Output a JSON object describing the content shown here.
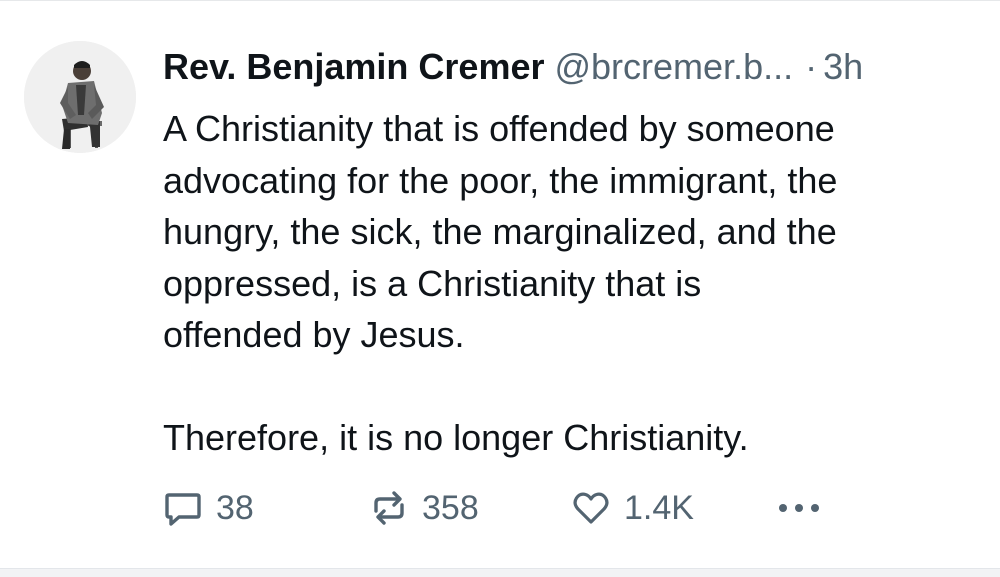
{
  "post": {
    "author_name": "Rev. Benjamin Cremer",
    "author_handle": "@brcremer.b...",
    "separator": "·",
    "timestamp": "3h",
    "paragraphs": [
      "A Christianity that is offended by someone advocating for the poor, the immigrant, the hungry, the sick, the marginalized, and the oppressed, is a Christianity that is offended by Jesus.",
      "Therefore, it is no longer Christianity."
    ],
    "line_breaks": [
      "A Christianity that is offended by someone\nadvocating for the poor, the immigrant, the\nhungry, the sick, the marginalized, and the\noppressed, is a Christianity that is\noffended by Jesus.",
      "Therefore, it is no longer Christianity."
    ]
  },
  "actions": {
    "reply_count": "38",
    "repost_count": "358",
    "like_count": "1.4K",
    "reply_icon": "speech-bubble-icon",
    "repost_icon": "repost-arrows-icon",
    "like_icon": "heart-outline-icon",
    "more_icon": "ellipsis-icon"
  },
  "colors": {
    "text_primary": "#0f1419",
    "text_secondary": "#536471"
  }
}
